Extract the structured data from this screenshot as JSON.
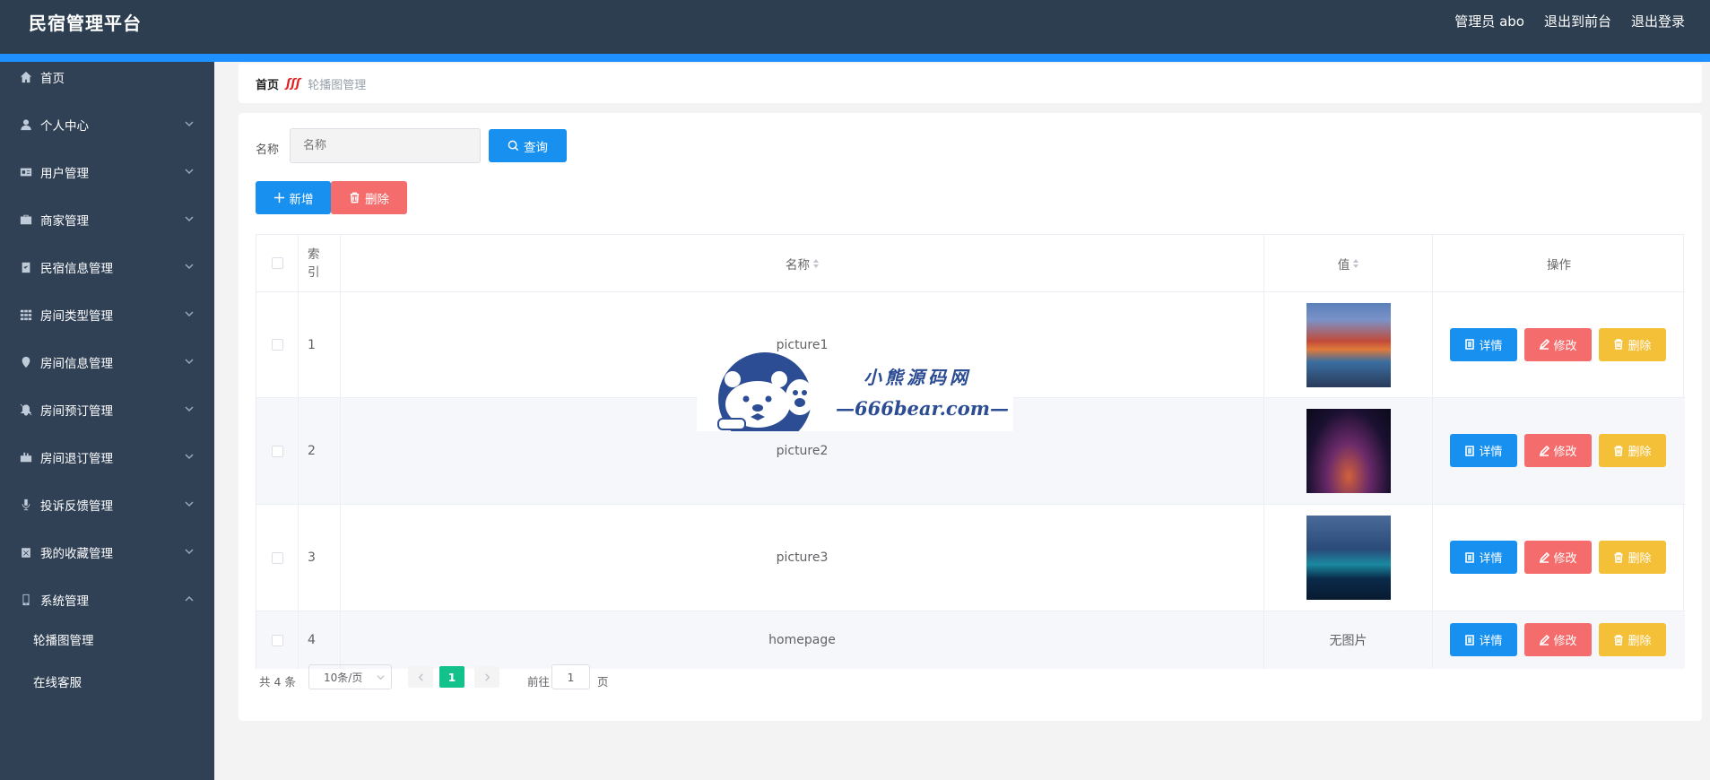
{
  "topbar": {
    "brand": "民宿管理平台",
    "admin": "管理员 abo",
    "to_front": "退出到前台",
    "logout": "退出登录"
  },
  "sidebar": {
    "items": [
      {
        "label": "首页",
        "icon": "home-icon"
      },
      {
        "label": "个人中心",
        "icon": "user-icon"
      },
      {
        "label": "用户管理",
        "icon": "id-card-icon"
      },
      {
        "label": "商家管理",
        "icon": "briefcase-icon"
      },
      {
        "label": "民宿信息管理",
        "icon": "checklist-icon"
      },
      {
        "label": "房间类型管理",
        "icon": "grid-icon"
      },
      {
        "label": "房间信息管理",
        "icon": "location-icon"
      },
      {
        "label": "房间预订管理",
        "icon": "bell-off-icon"
      },
      {
        "label": "房间退订管理",
        "icon": "cart-icon"
      },
      {
        "label": "投诉反馈管理",
        "icon": "microphone-icon"
      },
      {
        "label": "我的收藏管理",
        "icon": "box-icon"
      },
      {
        "label": "系统管理",
        "icon": "phone-icon"
      }
    ],
    "sub_items": [
      {
        "label": "轮播图管理"
      },
      {
        "label": "在线客服"
      }
    ]
  },
  "breadcrumb": {
    "home": "首页",
    "current": "轮播图管理"
  },
  "search": {
    "label": "名称",
    "placeholder": "名称",
    "button": "查询"
  },
  "actions": {
    "add": "新增",
    "delete": "删除"
  },
  "table": {
    "headers": {
      "index": "索引",
      "name": "名称",
      "value": "值",
      "ops": "操作"
    },
    "rows": [
      {
        "index": "1",
        "name": "picture1",
        "value": ""
      },
      {
        "index": "2",
        "name": "picture2",
        "value": ""
      },
      {
        "index": "3",
        "name": "picture3",
        "value": ""
      },
      {
        "index": "4",
        "name": "homepage",
        "value": "无图片"
      }
    ],
    "op_labels": {
      "detail": "详情",
      "edit": "修改",
      "delete": "删除"
    }
  },
  "pagination": {
    "total": "共 4 条",
    "page_size": "10条/页",
    "current_page": "1",
    "goto_label": "前往",
    "goto_value": "1",
    "page_suffix": "页"
  },
  "watermark": {
    "cn": "小熊源码网",
    "en": "—666bear.com—"
  },
  "colors": {
    "topbar": "#2c3e50",
    "accent_stripe": "#1e90ff",
    "sidebar": "#304156",
    "primary": "#1890f0",
    "danger": "#f56c6c",
    "warning": "#f4c038",
    "active_page": "#13c28a"
  }
}
